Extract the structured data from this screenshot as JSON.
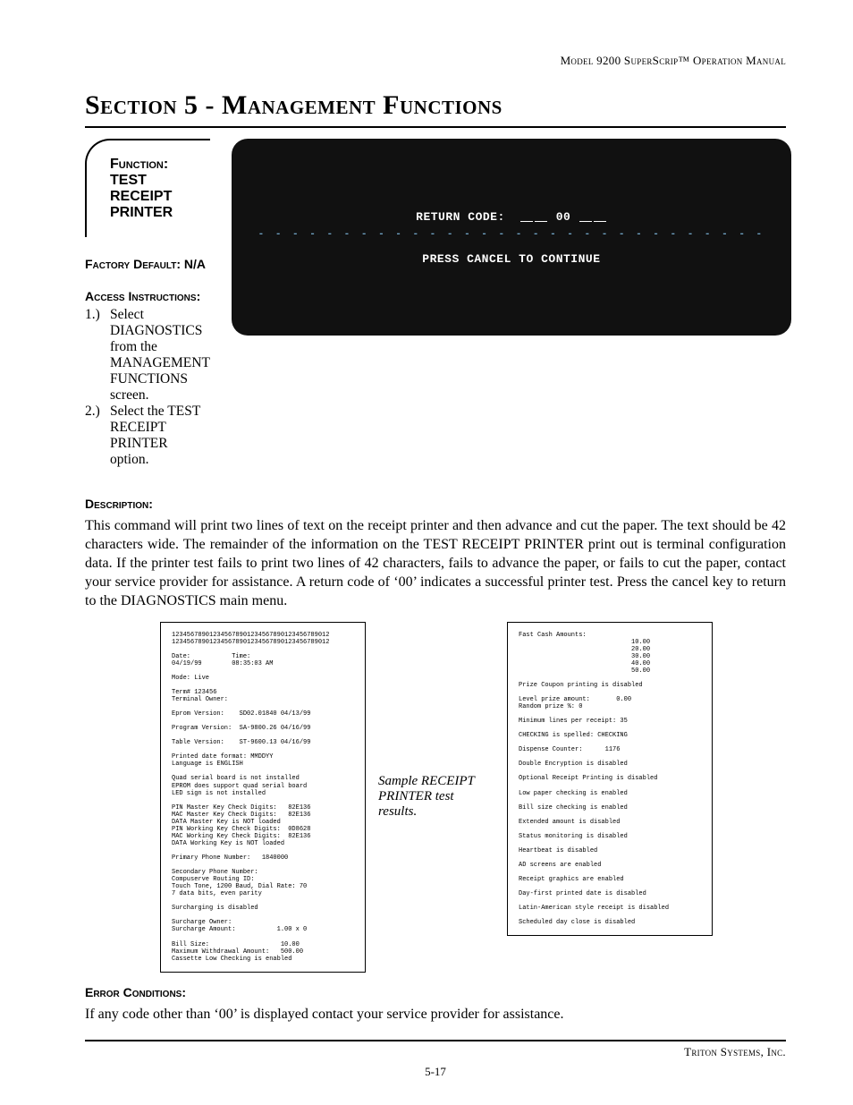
{
  "header": {
    "running_head": "Model 9200 SuperScrip™ Operation Manual"
  },
  "title": "Section 5 - Management Functions",
  "function_box": {
    "label_prefix": "Function:  ",
    "label_value": "TEST RECEIPT PRINTER"
  },
  "factory_default": {
    "label": "Factory Default: ",
    "value": "N/A"
  },
  "access": {
    "label": "Access Instructions:",
    "steps": [
      {
        "num": "1.)",
        "text": "Select DIAGNOSTICS from the MANAGEMENT FUNCTIONS screen."
      },
      {
        "num": "2.)",
        "text": "Select the TEST RECEIPT PRINTER option."
      }
    ]
  },
  "screen": {
    "return_label": "RETURN CODE:",
    "return_value": "00",
    "dots": "- - - - - - - - - - - - - - - - - - - - - - - - - - - - - -",
    "continue": "PRESS CANCEL TO CONTINUE"
  },
  "description": {
    "label": "Description:",
    "text": "This command will print two lines of text on the receipt printer and then advance and cut the paper. The text should be 42 characters wide.  The remainder of the information on the TEST RECEIPT PRINTER print out is terminal configuration data.  If the printer test fails to print two lines of 42 characters, fails to advance the paper, or fails to cut the paper, contact your service provider for assistance.  A return code of ‘00’ indicates a successful printer test.  Press the cancel key to return to the DIAGNOSTICS main menu."
  },
  "sample_caption": "Sample RECEIPT PRINTER test results.",
  "receipt_left": "123456789012345678901234567890123456789012\n123456789012345678901234567890123456789012\n\nDate:           Time:\n04/19/99        08:35:03 AM\n\nMode: Live\n\nTerm# 123456\nTerminal Owner:\n\nEprom Version:    SD02.01840 04/13/99\n\nProgram Version:  SA-9800.26 04/16/99\n\nTable Version:    ST-9600.13 04/16/99\n\nPrinted date format: MMDDYY\nLanguage is ENGLISH\n\nQuad serial board is not installed\nEPROM does support quad serial board\nLED sign is not installed\n\nPIN Master Key Check Digits:   82E136\nMAC Master Key Check Digits:   82E136\nDATA Master Key is NOT loaded\nPIN Working Key Check Digits:  0D8628\nMAC Working Key Check Digits:  82E136\nDATA Working Key is NOT loaded\n\nPrimary Phone Number:   1840000\n\nSecondary Phone Number:\nCompuserve Routing ID:\nTouch Tone, 1200 Baud, Dial Rate: 70\n7 data bits, even parity\n\nSurcharging is disabled\n\nSurcharge Owner:\nSurcharge Amount:           1.00 x 0\n\nBill Size:                   10.00\nMaximum Withdrawal Amount:   500.00\nCassette Low Checking is enabled",
  "receipt_right": "Fast Cash Amounts:\n                              10.00\n                              20.00\n                              30.00\n                              40.00\n                              50.00\n\nPrize Coupon printing is disabled\n\nLevel prize amount:       0.00\nRandom prize %: 0\n\nMinimum lines per receipt: 35\n\nCHECKING is spelled: CHECKING\n\nDispense Counter:      1176\n\nDouble Encryption is disabled\n\nOptional Receipt Printing is disabled\n\nLow paper checking is enabled\n\nBill size checking is enabled\n\nExtended amount is disabled\n\nStatus monitoring is disabled\n\nHeartbeat is disabled\n\nAD screens are enabled\n\nReceipt graphics are enabled\n\nDay-first printed date is disabled\n\nLatin-American style receipt is disabled\n\nScheduled day close is disabled",
  "errors": {
    "label": "Error Conditions:",
    "text": "If any code other than ‘00’ is displayed contact your service provider for assistance."
  },
  "footer": {
    "company": "Triton Systems, Inc.",
    "page": "5-17"
  }
}
